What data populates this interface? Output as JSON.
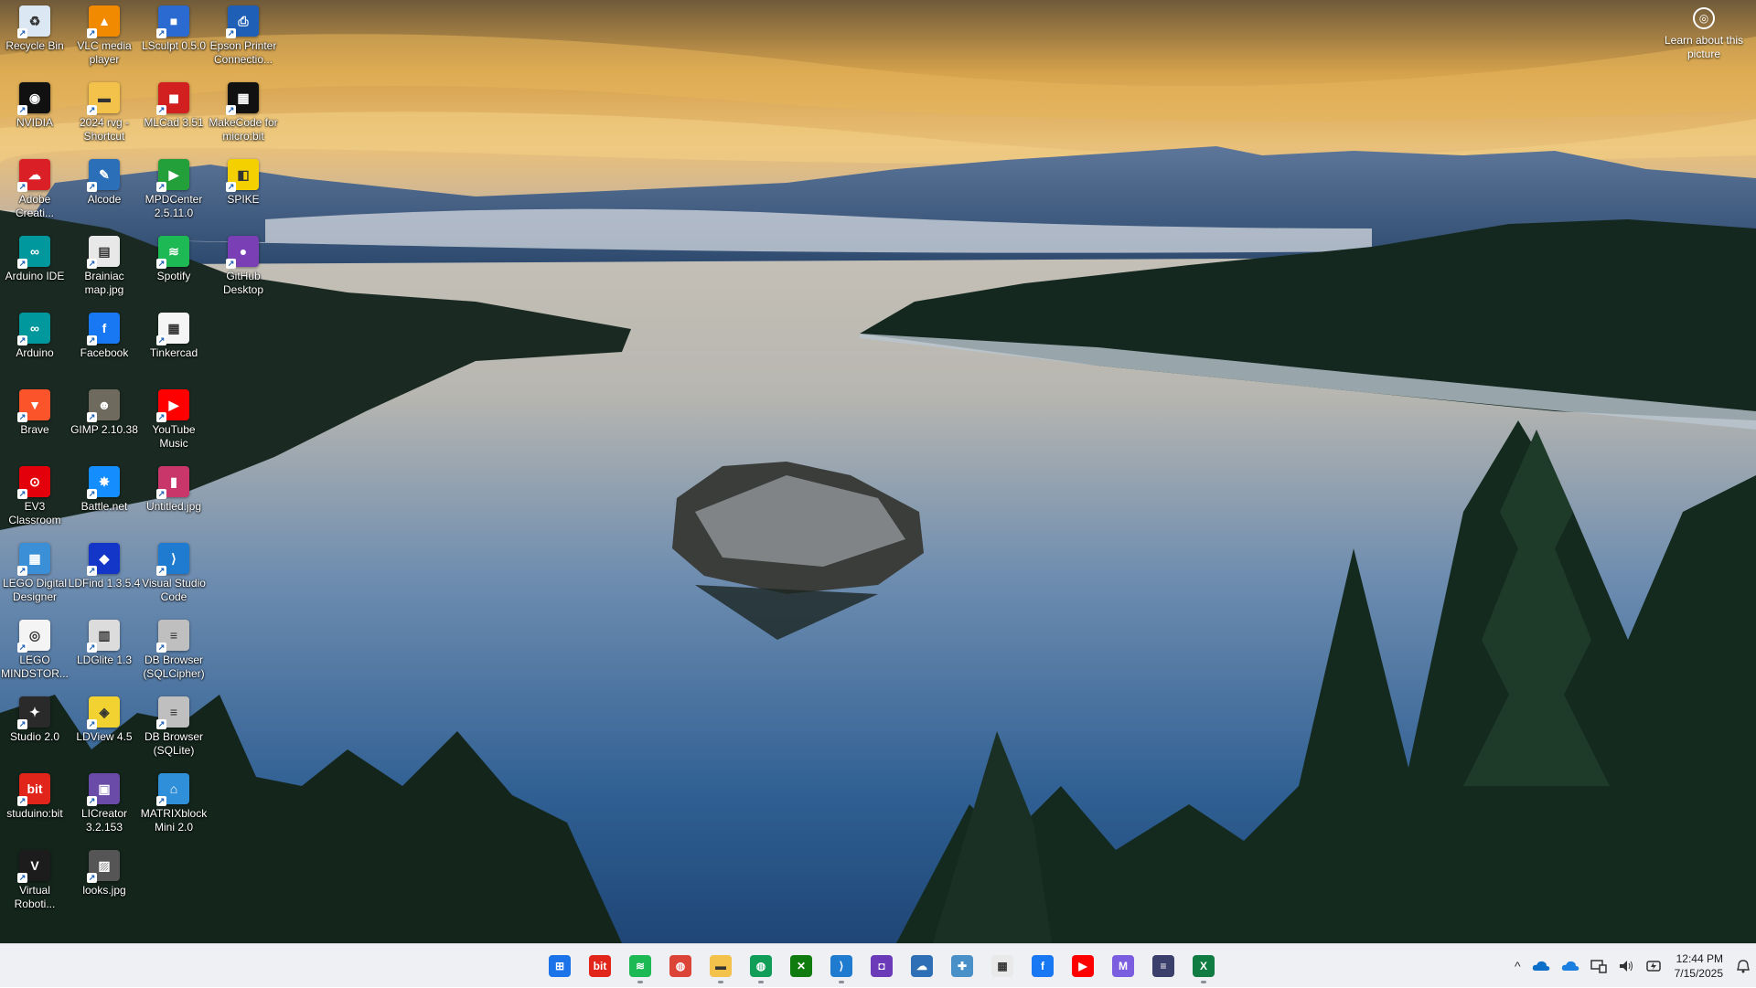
{
  "desktop": {
    "icons": [
      {
        "label": "Recycle Bin",
        "icon": "recycle-bin-icon",
        "color": "#dbe7f3",
        "glyph": "♻"
      },
      {
        "label": "NVIDIA",
        "icon": "nvidia-icon",
        "color": "#111111",
        "glyph": "◉"
      },
      {
        "label": "Adobe Creati...",
        "icon": "adobe-creative-cloud-icon",
        "color": "#da1f26",
        "glyph": "☁"
      },
      {
        "label": "Arduino IDE",
        "icon": "arduino-ide-icon",
        "color": "#00979d",
        "glyph": "∞"
      },
      {
        "label": "Arduino",
        "icon": "arduino-icon",
        "color": "#00979d",
        "glyph": "∞"
      },
      {
        "label": "Brave",
        "icon": "brave-icon",
        "color": "#fb542b",
        "glyph": "▼"
      },
      {
        "label": "EV3 Classroom",
        "icon": "ev3-classroom-icon",
        "color": "#e3000b",
        "glyph": "⊙"
      },
      {
        "label": "LEGO Digital Designer",
        "icon": "lego-digital-designer-icon",
        "color": "#3a8fd6",
        "glyph": "▦"
      },
      {
        "label": "LEGO MINDSTOR...",
        "icon": "lego-mindstorms-icon",
        "color": "#f4f4f4",
        "glyph": "◎"
      },
      {
        "label": "Studio 2.0",
        "icon": "studio-icon",
        "color": "#2a2a2a",
        "glyph": "✦"
      },
      {
        "label": "studuino:bit",
        "icon": "studuino-bit-icon",
        "color": "#e1251b",
        "glyph": "bit"
      },
      {
        "label": "Virtual Roboti...",
        "icon": "virtual-robotics-icon",
        "color": "#1c1c1c",
        "glyph": "V"
      },
      {
        "label": "VLC media player",
        "icon": "vlc-icon",
        "color": "#f28a00",
        "glyph": "▲"
      },
      {
        "label": "2024 rvg - Shortcut",
        "icon": "folder-icon",
        "color": "#f3c24a",
        "glyph": "▬"
      },
      {
        "label": "Alcode",
        "icon": "alcode-icon",
        "color": "#2a6fb8",
        "glyph": "✎"
      },
      {
        "label": "Brainiac map.jpg",
        "icon": "image-file-icon",
        "color": "#e8e8e8",
        "glyph": "▤"
      },
      {
        "label": "Facebook",
        "icon": "facebook-icon",
        "color": "#1877f2",
        "glyph": "f"
      },
      {
        "label": "GIMP 2.10.38",
        "icon": "gimp-icon",
        "color": "#6e6a5e",
        "glyph": "☻"
      },
      {
        "label": "Battle.net",
        "icon": "battlenet-icon",
        "color": "#148eff",
        "glyph": "✸"
      },
      {
        "label": "LDFind 1.3.5.4",
        "icon": "ldfind-icon",
        "color": "#1336c9",
        "glyph": "◆"
      },
      {
        "label": "LDGlite 1.3",
        "icon": "ldglite-icon",
        "color": "#dcdcdc",
        "glyph": "▥"
      },
      {
        "label": "LDView 4.5",
        "icon": "ldview-icon",
        "color": "#f2d230",
        "glyph": "◈"
      },
      {
        "label": "LICreator 3.2.153",
        "icon": "licreator-icon",
        "color": "#6a4ca8",
        "glyph": "▣"
      },
      {
        "label": "looks.jpg",
        "icon": "image-file-icon",
        "color": "#555555",
        "glyph": "▨"
      },
      {
        "label": "LSculpt 0.5.0",
        "icon": "lsculpt-icon",
        "color": "#2b6ad1",
        "glyph": "■"
      },
      {
        "label": "MLCad 3.51",
        "icon": "mlcad-icon",
        "color": "#d22020",
        "glyph": "◼"
      },
      {
        "label": "MPDCenter 2.5.11.0",
        "icon": "mpdcenter-icon",
        "color": "#23a03a",
        "glyph": "▶"
      },
      {
        "label": "Spotify",
        "icon": "spotify-icon",
        "color": "#1db954",
        "glyph": "≋"
      },
      {
        "label": "Tinkercad",
        "icon": "tinkercad-icon",
        "color": "#f5f5f5",
        "glyph": "▦"
      },
      {
        "label": "YouTube Music",
        "icon": "youtube-music-icon",
        "color": "#ff0000",
        "glyph": "▶"
      },
      {
        "label": "Untitled.jpg",
        "icon": "image-file-icon",
        "color": "#c8366a",
        "glyph": "▮"
      },
      {
        "label": "Visual Studio Code",
        "icon": "vscode-icon",
        "color": "#1f7bd0",
        "glyph": "⟩"
      },
      {
        "label": "DB Browser (SQLCipher)",
        "icon": "db-browser-icon",
        "color": "#bfbfbf",
        "glyph": "≡"
      },
      {
        "label": "DB Browser (SQLite)",
        "icon": "db-browser-icon",
        "color": "#bfbfbf",
        "glyph": "≡"
      },
      {
        "label": "MATRIXblock Mini 2.0",
        "icon": "matrixblock-icon",
        "color": "#2f8fd8",
        "glyph": "⌂"
      },
      {
        "label": "Epson Printer Connectio...",
        "icon": "epson-icon",
        "color": "#1f5fb6",
        "glyph": "⎙"
      },
      {
        "label": "MakeCode for micro:bit",
        "icon": "makecode-icon",
        "color": "#111111",
        "glyph": "▦"
      },
      {
        "label": "SPIKE",
        "icon": "spike-icon",
        "color": "#f5d000",
        "glyph": "◧"
      },
      {
        "label": "GitHub Desktop",
        "icon": "github-desktop-icon",
        "color": "#7a3fb5",
        "glyph": "●"
      }
    ]
  },
  "spotlight": {
    "label": "Learn about this picture",
    "icon": "camera-icon"
  },
  "taskbar": {
    "apps": [
      {
        "name": "start-button",
        "icon": "windows-start-icon",
        "color": "#1a73e8",
        "glyph": "⊞",
        "running": false
      },
      {
        "name": "taskbar-studuino",
        "icon": "studuino-bit-icon",
        "color": "#e1251b",
        "glyph": "bit",
        "running": false
      },
      {
        "name": "taskbar-spotify",
        "icon": "spotify-icon",
        "color": "#1db954",
        "glyph": "≋",
        "running": true
      },
      {
        "name": "taskbar-chrome",
        "icon": "chrome-icon",
        "color": "#db4437",
        "glyph": "◍",
        "running": false
      },
      {
        "name": "taskbar-file-explorer",
        "icon": "folder-icon",
        "color": "#f3c24a",
        "glyph": "▬",
        "running": true
      },
      {
        "name": "taskbar-chrome-profile",
        "icon": "chrome-icon",
        "color": "#0f9d58",
        "glyph": "◍",
        "running": true
      },
      {
        "name": "taskbar-xbox",
        "icon": "xbox-icon",
        "color": "#107c10",
        "glyph": "✕",
        "running": false
      },
      {
        "name": "taskbar-vscode",
        "icon": "vscode-icon",
        "color": "#1f7bd0",
        "glyph": "⟩",
        "running": true
      },
      {
        "name": "taskbar-camera-app",
        "icon": "app-icon",
        "color": "#6a3ab8",
        "glyph": "◘",
        "running": false
      },
      {
        "name": "taskbar-onedrive-app",
        "icon": "cloud-app-icon",
        "color": "#2f6fb5",
        "glyph": "☁",
        "running": false
      },
      {
        "name": "taskbar-puzzle-app",
        "icon": "puzzle-icon",
        "color": "#4a90c8",
        "glyph": "✚",
        "running": false
      },
      {
        "name": "taskbar-tinkercad",
        "icon": "tinkercad-icon",
        "color": "#e9e9e9",
        "glyph": "▦",
        "running": false
      },
      {
        "name": "taskbar-facebook",
        "icon": "facebook-icon",
        "color": "#1877f2",
        "glyph": "f",
        "running": false
      },
      {
        "name": "taskbar-youtube-music",
        "icon": "youtube-music-icon",
        "color": "#ff0000",
        "glyph": "▶",
        "running": false
      },
      {
        "name": "taskbar-m365",
        "icon": "microsoft-365-icon",
        "color": "#7b5de0",
        "glyph": "M",
        "running": false
      },
      {
        "name": "taskbar-stripe-app",
        "icon": "app-icon",
        "color": "#3a3f6b",
        "glyph": "≡",
        "running": false
      },
      {
        "name": "taskbar-excel",
        "icon": "excel-icon",
        "color": "#107c41",
        "glyph": "X",
        "running": true
      }
    ],
    "tray": {
      "chevron": "^",
      "time": "12:44 PM",
      "date": "7/15/2025"
    }
  }
}
